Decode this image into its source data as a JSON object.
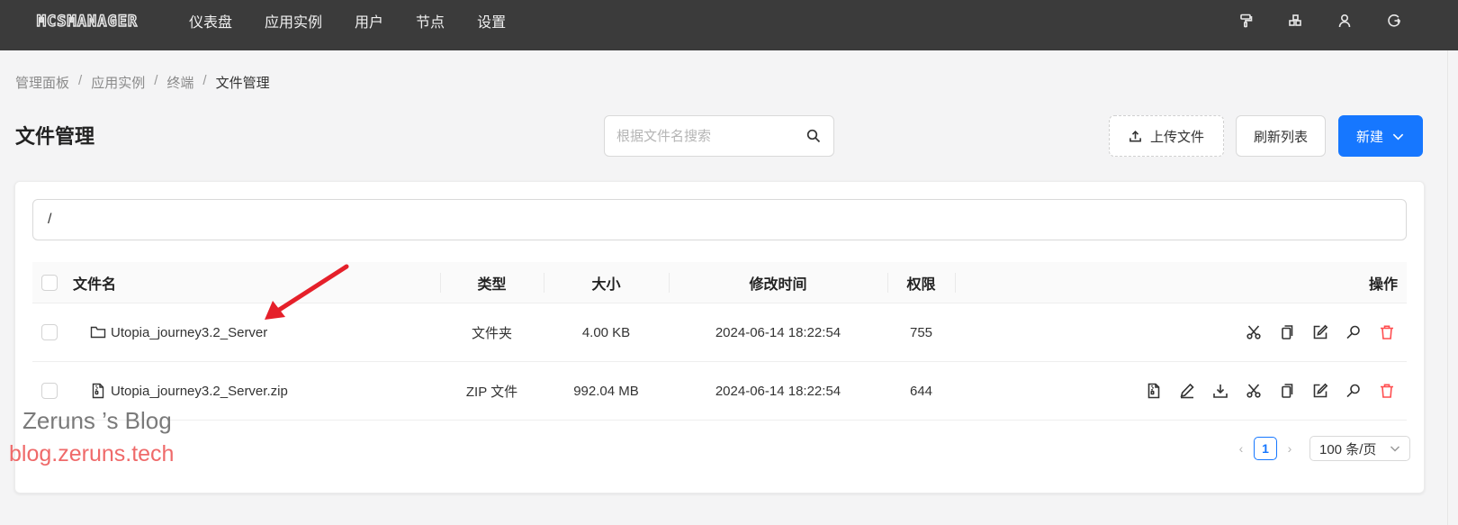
{
  "app": {
    "logo_text": "MCSMANAGER"
  },
  "nav": {
    "items": [
      "仪表盘",
      "应用实例",
      "用户",
      "节点",
      "设置"
    ]
  },
  "top_icons": [
    "paint-roller-icon",
    "nodes-icon",
    "user-icon",
    "logout-icon"
  ],
  "breadcrumb": {
    "items": [
      "管理面板",
      "应用实例",
      "终端"
    ],
    "separator": "/",
    "current": "文件管理"
  },
  "page": {
    "title": "文件管理"
  },
  "search": {
    "placeholder": "根据文件名搜索",
    "value": ""
  },
  "toolbar": {
    "upload_label": "上传文件",
    "refresh_label": "刷新列表",
    "new_label": "新建"
  },
  "path": {
    "value": "/"
  },
  "table": {
    "headers": {
      "name": "文件名",
      "type": "类型",
      "size": "大小",
      "modified": "修改时间",
      "permission": "权限",
      "actions": "操作"
    },
    "rows": [
      {
        "name": "Utopia_journey3.2_Server",
        "type": "文件夹",
        "size": "4.00 KB",
        "modified": "2024-06-14 18:22:54",
        "permission": "755",
        "icon": "folder-icon"
      },
      {
        "name": "Utopia_journey3.2_Server.zip",
        "type": "ZIP 文件",
        "size": "992.04 MB",
        "modified": "2024-06-14 18:22:54",
        "permission": "644",
        "icon": "zip-file-icon"
      }
    ]
  },
  "pagination": {
    "current_page": "1",
    "page_size": "100 条/页"
  },
  "watermark": {
    "title": "Zeruns ’s Blog",
    "url": "blog.zeruns.tech"
  },
  "colors": {
    "topbar": "#3b3b3b",
    "primary": "#1677ff",
    "danger": "#ff4d4f",
    "watermark_url": "#ef6a6a",
    "annotation_arrow": "#e5202a"
  }
}
